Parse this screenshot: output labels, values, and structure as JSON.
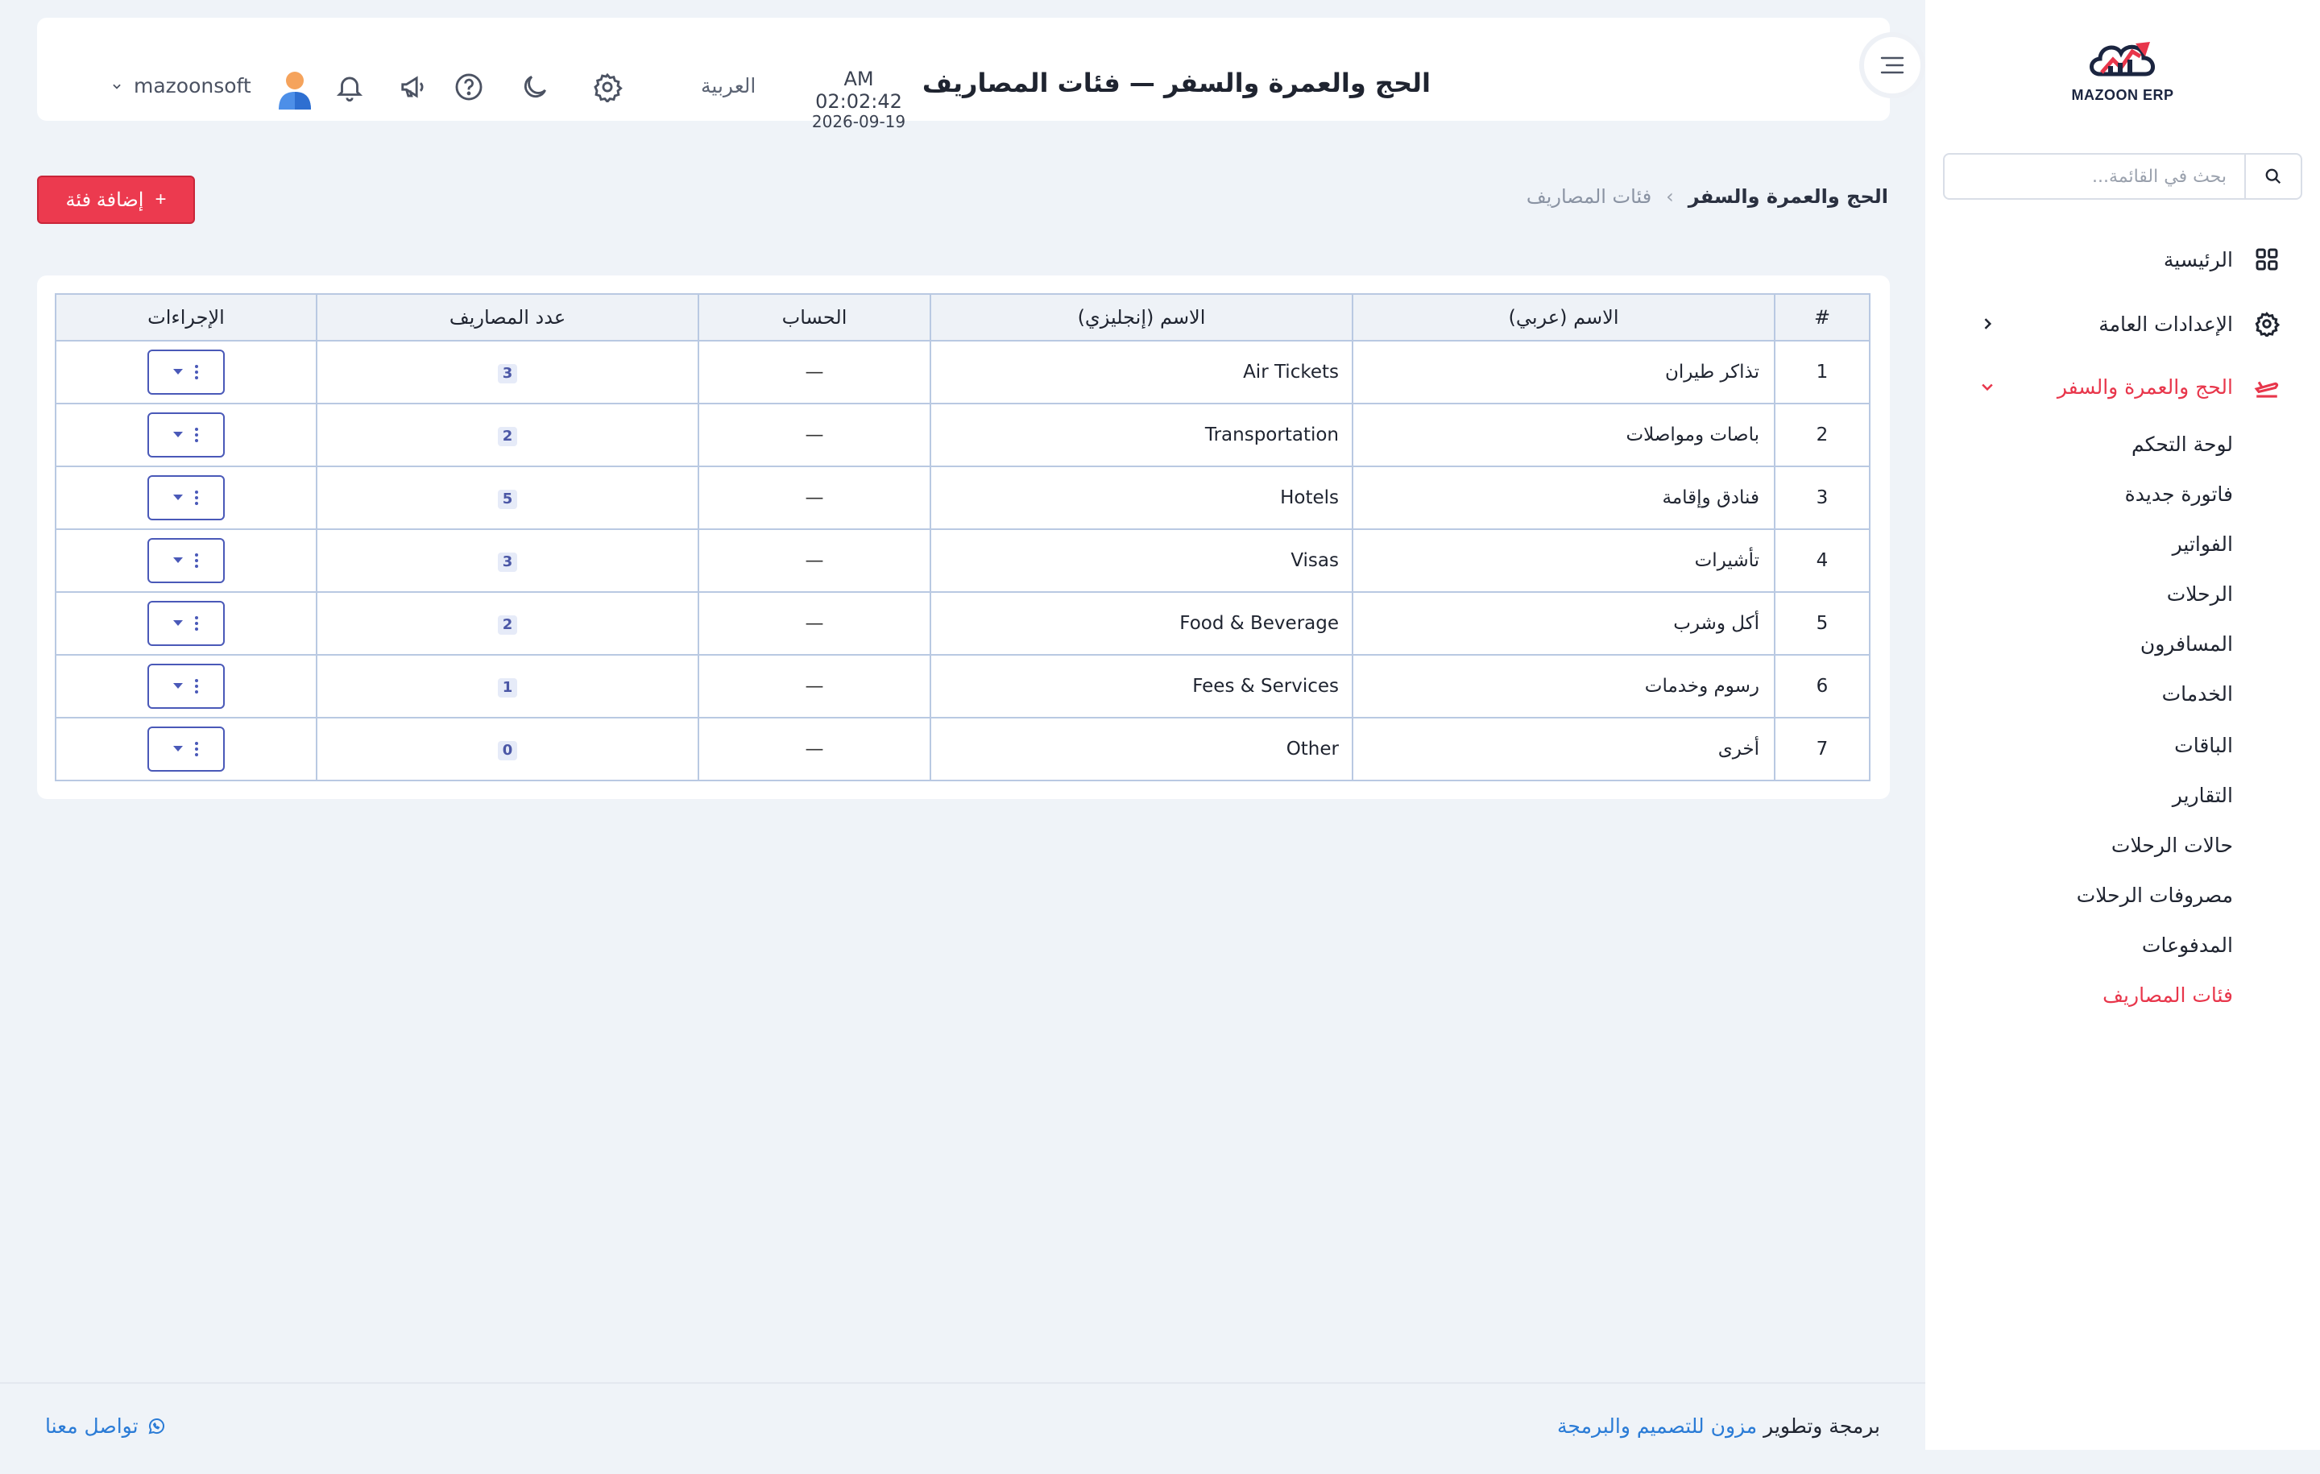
{
  "sidebar": {
    "logo_text": "MAZOON ERP",
    "search_placeholder": "بحث في القائمة...",
    "menu": [
      {
        "label": "الرئيسية",
        "icon": "grid-icon"
      },
      {
        "label": "الإعدادات العامة",
        "icon": "gear-icon"
      },
      {
        "label": "الحج والعمرة والسفر",
        "icon": "plane-icon",
        "active": true
      }
    ],
    "submenu": [
      "لوحة التحكم",
      "فاتورة جديدة",
      "الفواتير",
      "الرحلات",
      "المسافرون",
      "الخدمات",
      "الباقات",
      "التقارير",
      "حالات الرحلات",
      "مصروفات الرحلات",
      "المدفوعات",
      "فئات المصاريف"
    ],
    "active_submenu": "فئات المصاريف"
  },
  "header": {
    "title": "الحج والعمرة والسفر — فئات المصاريف",
    "time": "AM 02:02:42",
    "date": "2026-09-19",
    "language": "العربية",
    "username": "mazoonsoft"
  },
  "breadcrumb": {
    "parent": "الحج والعمرة والسفر",
    "separator": "›",
    "current": "فئات المصاريف"
  },
  "add_button": {
    "plus": "+",
    "label": "إضافة فئة"
  },
  "table": {
    "headers": {
      "num": "#",
      "name_ar": "الاسم (عربي)",
      "name_en": "الاسم (إنجليزي)",
      "account": "الحساب",
      "count": "عدد المصاريف",
      "actions": "الإجراءات"
    },
    "rows": [
      {
        "num": "1",
        "name_ar": "تذاكر طيران",
        "name_en": "Air Tickets",
        "account": "—",
        "count": "3"
      },
      {
        "num": "2",
        "name_ar": "باصات ومواصلات",
        "name_en": "Transportation",
        "account": "—",
        "count": "2"
      },
      {
        "num": "3",
        "name_ar": "فنادق وإقامة",
        "name_en": "Hotels",
        "account": "—",
        "count": "5"
      },
      {
        "num": "4",
        "name_ar": "تأشيرات",
        "name_en": "Visas",
        "account": "—",
        "count": "3"
      },
      {
        "num": "5",
        "name_ar": "أكل وشرب",
        "name_en": "Food & Beverage",
        "account": "—",
        "count": "2"
      },
      {
        "num": "6",
        "name_ar": "رسوم وخدمات",
        "name_en": "Fees & Services",
        "account": "—",
        "count": "1"
      },
      {
        "num": "7",
        "name_ar": "أخرى",
        "name_en": "Other",
        "account": "—",
        "count": "0"
      }
    ]
  },
  "footer": {
    "credit_prefix": "برمجة وتطوير",
    "credit_link": "مزون للتصميم والبرمجة",
    "contact": "تواصل معنا"
  },
  "colors": {
    "accent": "#e8364b",
    "link": "#2a7bd6",
    "action_border": "#4a59b8",
    "background": "#eff3f8"
  }
}
